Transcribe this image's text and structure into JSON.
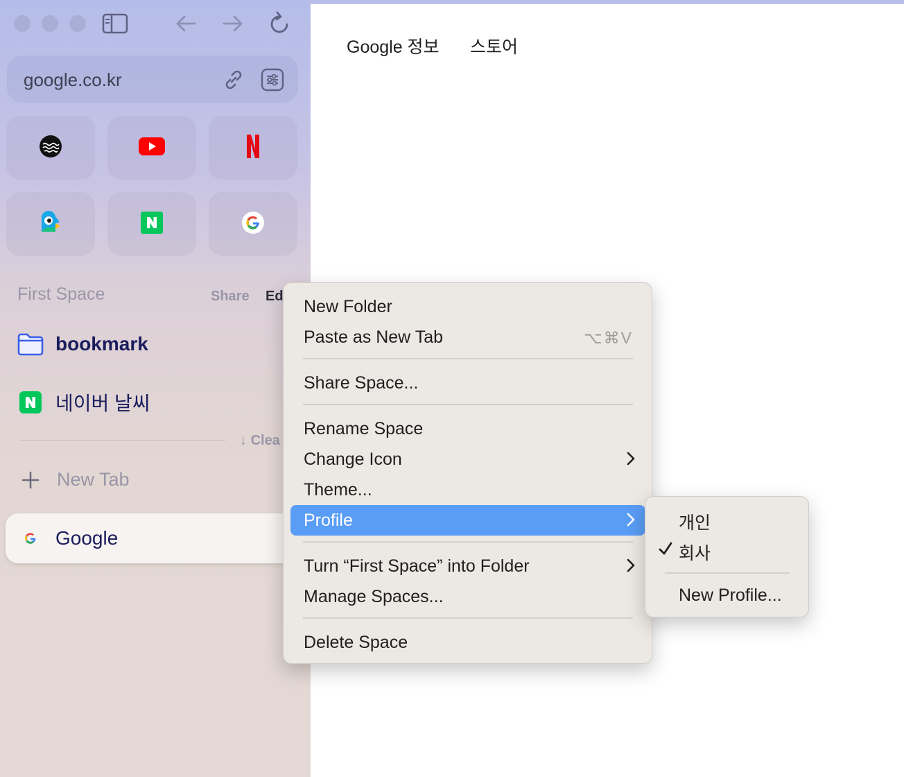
{
  "sidebar": {
    "url": "google.co.kr",
    "favorites": [
      {
        "name": "wave-site-icon"
      },
      {
        "name": "youtube-icon"
      },
      {
        "name": "netflix-icon"
      },
      {
        "name": "bird-site-icon"
      },
      {
        "name": "naver-icon"
      },
      {
        "name": "google-icon"
      }
    ],
    "space": {
      "title": "First Space",
      "share_label": "Share",
      "edit_label": "Ed"
    },
    "pinned": [
      {
        "label": "bookmark",
        "icon": "folder-icon"
      },
      {
        "label": "네이버 날씨",
        "icon": "naver-icon"
      }
    ],
    "clear_label": "Clea",
    "new_tab_label": "New Tab",
    "active_tab": {
      "label": "Google",
      "icon": "google-icon"
    }
  },
  "page": {
    "nav": [
      "Google 정보",
      "스토어"
    ]
  },
  "context_menu": {
    "items": {
      "new_folder": "New Folder",
      "paste_new_tab": "Paste as New Tab",
      "paste_shortcut": "⌥⌘V",
      "share_space": "Share Space...",
      "rename_space": "Rename Space",
      "change_icon": "Change Icon",
      "theme": "Theme...",
      "profile": "Profile",
      "turn_into_folder": "Turn “First Space” into Folder",
      "manage_spaces": "Manage Spaces...",
      "delete_space": "Delete Space"
    }
  },
  "profile_submenu": {
    "items": [
      "개인",
      "회사"
    ],
    "checked": "회사",
    "new_profile": "New Profile..."
  },
  "colors": {
    "highlight": "#5a9df6",
    "menu_bg": "#ece8e3",
    "accent_text": "#1a1c5c"
  }
}
